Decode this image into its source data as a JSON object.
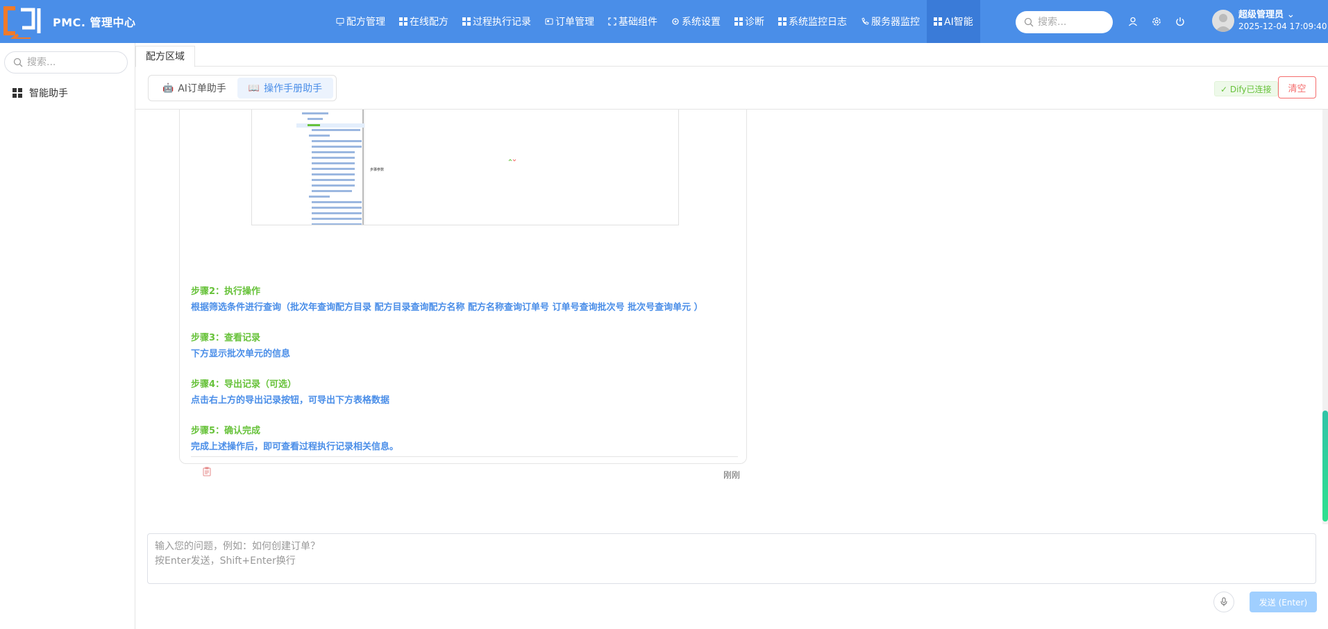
{
  "app": {
    "title": "PMC. 管理中心"
  },
  "nav": [
    {
      "label": "配方管理",
      "icon": "monitor-icon"
    },
    {
      "label": "在线配方",
      "icon": "grid-icon"
    },
    {
      "label": "过程执行记录",
      "icon": "grid-icon"
    },
    {
      "label": "订单管理",
      "icon": "card-icon"
    },
    {
      "label": "基础组件",
      "icon": "fullscreen-icon"
    },
    {
      "label": "系统设置",
      "icon": "gear-icon"
    },
    {
      "label": "诊断",
      "icon": "grid-icon"
    },
    {
      "label": "系统监控日志",
      "icon": "grid-icon"
    },
    {
      "label": "服务器监控",
      "icon": "phone-icon"
    },
    {
      "label": "AI智能",
      "icon": "grid-icon"
    }
  ],
  "top_search": {
    "placeholder": "搜索..."
  },
  "user": {
    "name": "超级管理员",
    "datetime": "2025-12-04 17:09:40"
  },
  "sidebar": {
    "search_placeholder": "搜索...",
    "items": [
      {
        "label": "智能助手"
      }
    ]
  },
  "tabs": [
    {
      "label": "配方区域"
    }
  ],
  "assistant_tabs": [
    {
      "label": "AI订单助手",
      "active": false
    },
    {
      "label": "操作手册助手",
      "active": true
    }
  ],
  "status": {
    "connection": "✓ Dify已连接"
  },
  "actions": {
    "clear": "清空"
  },
  "screenshot": {
    "label": "步骤参数"
  },
  "steps": [
    {
      "title": "步骤2：执行操作",
      "desc": "根据筛选条件进行查询（批次年查询配方目录 配方目录查询配方名称 配方名称查询订单号 订单号查询批次号 批次号查询单元 ）"
    },
    {
      "title": "步骤3：查看记录",
      "desc": "下方显示批次单元的信息"
    },
    {
      "title": "步骤4：导出记录（可选）",
      "desc": "点击右上方的导出记录按钮，可导出下方表格数据"
    },
    {
      "title": "步骤5：确认完成",
      "desc": "完成上述操作后，即可查看过程执行记录相关信息。"
    }
  ],
  "message": {
    "time": "刚刚"
  },
  "composer": {
    "placeholder": "输入您的问题，例如：如何创建订单？\n按Enter发送，Shift+Enter换行",
    "send_label": "发送 (Enter)"
  },
  "colors": {
    "primary": "#4a8ee8",
    "step_title": "#67c23a",
    "danger": "#f56c6c"
  }
}
